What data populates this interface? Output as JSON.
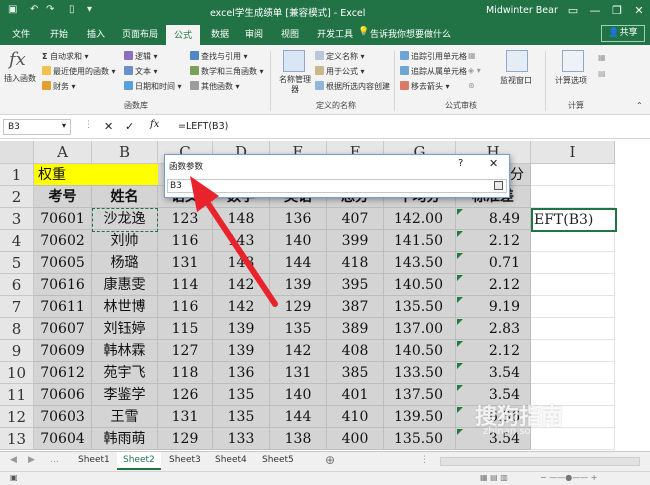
{
  "window": {
    "title": "excel学生成绩单 [兼容模式] - Excel",
    "user": "Midwinter Bear",
    "minimize": "—",
    "restore": "❐",
    "close": "✕"
  },
  "tabs": [
    {
      "label": "文件"
    },
    {
      "label": "开始"
    },
    {
      "label": "插入"
    },
    {
      "label": "页面布局"
    },
    {
      "label": "公式"
    },
    {
      "label": "数据"
    },
    {
      "label": "审阅"
    },
    {
      "label": "视图"
    },
    {
      "label": "开发工具"
    },
    {
      "label": "告诉我你想要做什么"
    }
  ],
  "share_label": "共享",
  "ribbon": {
    "insert_function": "插入函数",
    "autosum": "自动求和",
    "recent": "最近使用的函数",
    "financial": "财务",
    "logical": "逻辑",
    "text": "文本",
    "datetime": "日期和时间",
    "lookup": "查找与引用",
    "math": "数学和三角函数",
    "more": "其他函数",
    "library_group": "函数库",
    "name_manager": "名称管理器",
    "define_name": "定义名称",
    "use_in_formula": "用于公式",
    "create_from_sel": "根据所选内容创建",
    "names_group": "定义的名称",
    "trace_prec": "追踪引用单元格",
    "trace_dep": "追踪从属单元格",
    "remove_arrows": "移去箭头",
    "audit_group": "公式审核",
    "watch": "监视窗口",
    "calc_options": "计算选项",
    "calc_group": "计算"
  },
  "formula_bar": {
    "name_box": "B3",
    "fx": "fx",
    "formula": "=LEFT(B3)"
  },
  "columns": [
    "A",
    "B",
    "C",
    "D",
    "E",
    "F",
    "G",
    "H",
    "I"
  ],
  "rows": [
    {
      "n": "1",
      "cells": [
        "权重",
        "",
        "",
        "",
        "",
        "",
        "",
        "分"
      ]
    },
    {
      "n": "2",
      "cells": [
        "考号",
        "姓名",
        "语文",
        "数学",
        "英语",
        "总分",
        "平均分",
        "标准差"
      ]
    },
    {
      "n": "3",
      "cells": [
        "70601",
        "沙龙逸",
        "123",
        "148",
        "136",
        "407",
        "142.00",
        "8.49"
      ]
    },
    {
      "n": "4",
      "cells": [
        "70602",
        "刘帅",
        "116",
        "143",
        "140",
        "399",
        "141.50",
        "2.12"
      ]
    },
    {
      "n": "5",
      "cells": [
        "70605",
        "杨璐",
        "131",
        "143",
        "144",
        "418",
        "143.50",
        "0.71"
      ]
    },
    {
      "n": "6",
      "cells": [
        "70616",
        "康惠雯",
        "114",
        "142",
        "139",
        "395",
        "140.50",
        "2.12"
      ]
    },
    {
      "n": "7",
      "cells": [
        "70611",
        "林世博",
        "116",
        "142",
        "129",
        "387",
        "135.50",
        "9.19"
      ]
    },
    {
      "n": "8",
      "cells": [
        "70607",
        "刘钰婷",
        "115",
        "139",
        "135",
        "389",
        "137.00",
        "2.83"
      ]
    },
    {
      "n": "9",
      "cells": [
        "70609",
        "韩林霖",
        "127",
        "139",
        "142",
        "408",
        "140.50",
        "2.12"
      ]
    },
    {
      "n": "10",
      "cells": [
        "70612",
        "苑宇飞",
        "118",
        "136",
        "131",
        "385",
        "133.50",
        "3.54"
      ]
    },
    {
      "n": "11",
      "cells": [
        "70606",
        "李鉴学",
        "126",
        "135",
        "140",
        "401",
        "137.50",
        "3.54"
      ]
    },
    {
      "n": "12",
      "cells": [
        "70603",
        "王雪",
        "131",
        "135",
        "144",
        "410",
        "139.50",
        "6.36"
      ]
    },
    {
      "n": "13",
      "cells": [
        "70604",
        "韩雨萌",
        "129",
        "133",
        "138",
        "400",
        "135.50",
        "3.54"
      ]
    }
  ],
  "i3_text": "EFT(B3)",
  "dialog": {
    "title": "函数参数",
    "help": "?",
    "close": "✕",
    "input": "B3"
  },
  "sheets": [
    {
      "label": "Sheet1"
    },
    {
      "label": "Sheet2"
    },
    {
      "label": "Sheet3"
    },
    {
      "label": "Sheet4"
    },
    {
      "label": "Sheet5"
    }
  ],
  "add_sheet": "⊕",
  "watermark": "搜狗指南",
  "watermark_sub": "zhinan.sogou.com",
  "colors": {
    "accent": "#217346",
    "header_yellow": "#ffff00",
    "grid_gray": "#d4d4d4",
    "arrow_red": "#e8232b"
  }
}
